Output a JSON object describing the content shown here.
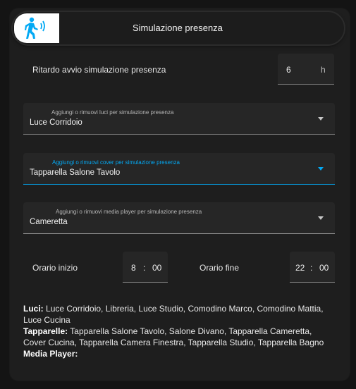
{
  "header": {
    "title": "Simulazione presenza",
    "icon": "walking-person-icon",
    "icon_bg": "#ffffff",
    "icon_color": "#03a9f4"
  },
  "delay": {
    "label": "Ritardo avvio simulazione presenza",
    "value": "6",
    "unit": "h"
  },
  "lights_select": {
    "label": "Aggiungi o rimuovi luci per simulazione presenza",
    "value": "Luce Corridoio"
  },
  "covers_select": {
    "label": "Aggiungi o rimuovi cover per simulazione presenza",
    "value": "Tapparella Salone Tavolo",
    "accent": "#03a9f4"
  },
  "media_select": {
    "label": "Aggiungi o rimuovi media player per simulazione presenza",
    "value": "Cameretta"
  },
  "start_time": {
    "label": "Orario inizio",
    "hour": "8",
    "minute": "00",
    "sep": ":"
  },
  "end_time": {
    "label": "Orario fine",
    "hour": "22",
    "minute": "00",
    "sep": ":"
  },
  "summary": {
    "lights_label": "Luci:",
    "lights_value": "Luce Corridoio, Libreria, Luce Studio, Comodino Marco, Comodino Mattia, Luce Cucina",
    "covers_label": "Tapparelle:",
    "covers_value": "Tapparella Salone Tavolo, Salone Divano, Tapparella Cameretta, Cover Cucina, Tapparella Camera Finestra, Tapparella Studio, Tapparella Bagno",
    "media_label": "Media Player:",
    "media_value": ""
  }
}
